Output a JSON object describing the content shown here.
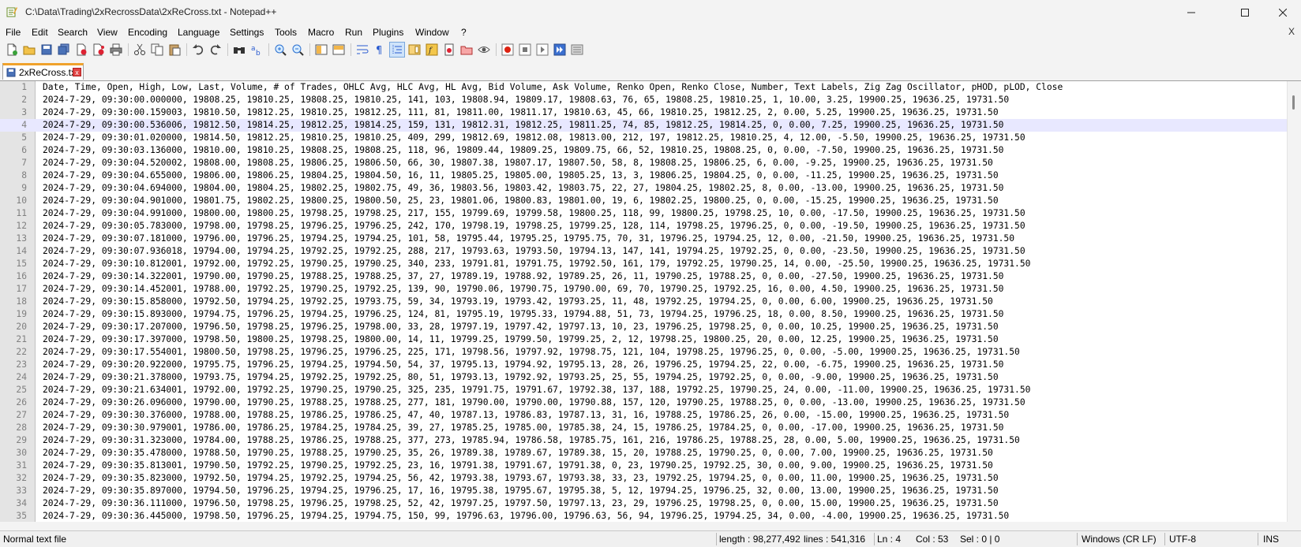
{
  "window": {
    "title": "C:\\Data\\Trading\\2xRecrossData\\2xReCross.txt - Notepad++",
    "minimize": "–",
    "maximize": "☐",
    "close": "✕"
  },
  "menu": {
    "items": [
      "File",
      "Edit",
      "Search",
      "View",
      "Encoding",
      "Language",
      "Settings",
      "Tools",
      "Macro",
      "Run",
      "Plugins",
      "Window",
      "?"
    ],
    "close_doc": "X"
  },
  "toolbar": {
    "icons": [
      "new-file-icon",
      "open-file-icon",
      "save-icon",
      "save-all-icon",
      "close-icon",
      "close-all-icon",
      "print-icon",
      "cut-icon",
      "copy-icon",
      "paste-icon",
      "undo-icon",
      "redo-icon",
      "find-icon",
      "replace-icon",
      "zoom-in-icon",
      "zoom-out-icon",
      "sync-vertical-icon",
      "sync-horizontal-icon",
      "word-wrap-icon",
      "show-all-characters-icon",
      "indent-guide-icon",
      "document-map-icon",
      "function-list-icon",
      "folder-as-workspace-icon",
      "project-panel-icon",
      "monitoring-icon",
      "record-macro-icon",
      "stop-recording-icon",
      "playback-macro-icon",
      "run-macro-multiple-icon",
      "save-macro-icon"
    ]
  },
  "tab": {
    "label": "2xReCross.txt",
    "close": "x"
  },
  "editor": {
    "current_line": 4,
    "lines": [
      "Date, Time, Open, High, Low, Last, Volume, # of Trades, OHLC Avg, HLC Avg, HL Avg, Bid Volume, Ask Volume, Renko Open, Renko Close, Number, Text Labels, Zig Zag Oscillator, pHOD, pLOD, Close",
      "2024-7-29, 09:30:00.000000, 19808.25, 19810.25, 19808.25, 19810.25, 141, 103, 19808.94, 19809.17, 19808.63, 76, 65, 19808.25, 19810.25, 1, 10.00, 3.25, 19900.25, 19636.25, 19731.50",
      "2024-7-29, 09:30:00.159003, 19810.50, 19812.25, 19810.25, 19812.25, 111, 81, 19811.00, 19811.17, 19810.63, 45, 66, 19810.25, 19812.25, 2, 0.00, 5.25, 19900.25, 19636.25, 19731.50",
      "2024-7-29, 09:30:00.536006, 19812.50, 19814.25, 19812.25, 19814.25, 159, 131, 19812.31, 19812.25, 19811.25, 74, 85, 19812.25, 19814.25, 0, 0.00, 7.25, 19900.25, 19636.25, 19731.50",
      "2024-7-29, 09:30:01.020000, 19814.50, 19812.25, 19810.25, 19810.25, 409, 299, 19812.69, 19812.08, 19813.00, 212, 197, 19812.25, 19810.25, 4, 12.00, -5.50, 19900.25, 19636.25, 19731.50",
      "2024-7-29, 09:30:03.136000, 19810.00, 19810.25, 19808.25, 19808.25, 118, 96, 19809.44, 19809.25, 19809.75, 66, 52, 19810.25, 19808.25, 0, 0.00, -7.50, 19900.25, 19636.25, 19731.50",
      "2024-7-29, 09:30:04.520002, 19808.00, 19808.25, 19806.25, 19806.50, 66, 30, 19807.38, 19807.17, 19807.50, 58, 8, 19808.25, 19806.25, 6, 0.00, -9.25, 19900.25, 19636.25, 19731.50",
      "2024-7-29, 09:30:04.655000, 19806.00, 19806.25, 19804.25, 19804.50, 16, 11, 19805.25, 19805.00, 19805.25, 13, 3, 19806.25, 19804.25, 0, 0.00, -11.25, 19900.25, 19636.25, 19731.50",
      "2024-7-29, 09:30:04.694000, 19804.00, 19804.25, 19802.25, 19802.75, 49, 36, 19803.56, 19803.42, 19803.75, 22, 27, 19804.25, 19802.25, 8, 0.00, -13.00, 19900.25, 19636.25, 19731.50",
      "2024-7-29, 09:30:04.901000, 19801.75, 19802.25, 19800.25, 19800.50, 25, 23, 19801.06, 19800.83, 19801.00, 19, 6, 19802.25, 19800.25, 0, 0.00, -15.25, 19900.25, 19636.25, 19731.50",
      "2024-7-29, 09:30:04.991000, 19800.00, 19800.25, 19798.25, 19798.25, 217, 155, 19799.69, 19799.58, 19800.25, 118, 99, 19800.25, 19798.25, 10, 0.00, -17.50, 19900.25, 19636.25, 19731.50",
      "2024-7-29, 09:30:05.783000, 19798.00, 19798.25, 19796.25, 19796.25, 242, 170, 19798.19, 19798.25, 19799.25, 128, 114, 19798.25, 19796.25, 0, 0.00, -19.50, 19900.25, 19636.25, 19731.50",
      "2024-7-29, 09:30:07.181000, 19796.00, 19796.25, 19794.25, 19794.25, 101, 58, 19795.44, 19795.25, 19795.75, 70, 31, 19796.25, 19794.25, 12, 0.00, -21.50, 19900.25, 19636.25, 19731.50",
      "2024-7-29, 09:30:07.936018, 19794.00, 19794.25, 19792.25, 19792.25, 288, 217, 19793.63, 19793.50, 19794.13, 147, 141, 19794.25, 19792.25, 0, 0.00, -23.50, 19900.25, 19636.25, 19731.50",
      "2024-7-29, 09:30:10.812001, 19792.00, 19792.25, 19790.25, 19790.25, 340, 233, 19791.81, 19791.75, 19792.50, 161, 179, 19792.25, 19790.25, 14, 0.00, -25.50, 19900.25, 19636.25, 19731.50",
      "2024-7-29, 09:30:14.322001, 19790.00, 19790.25, 19788.25, 19788.25, 37, 27, 19789.19, 19788.92, 19789.25, 26, 11, 19790.25, 19788.25, 0, 0.00, -27.50, 19900.25, 19636.25, 19731.50",
      "2024-7-29, 09:30:14.452001, 19788.00, 19792.25, 19790.25, 19792.25, 139, 90, 19790.06, 19790.75, 19790.00, 69, 70, 19790.25, 19792.25, 16, 0.00, 4.50, 19900.25, 19636.25, 19731.50",
      "2024-7-29, 09:30:15.858000, 19792.50, 19794.25, 19792.25, 19793.75, 59, 34, 19793.19, 19793.42, 19793.25, 11, 48, 19792.25, 19794.25, 0, 0.00, 6.00, 19900.25, 19636.25, 19731.50",
      "2024-7-29, 09:30:15.893000, 19794.75, 19796.25, 19794.25, 19796.25, 124, 81, 19795.19, 19795.33, 19794.88, 51, 73, 19794.25, 19796.25, 18, 0.00, 8.50, 19900.25, 19636.25, 19731.50",
      "2024-7-29, 09:30:17.207000, 19796.50, 19798.25, 19796.25, 19798.00, 33, 28, 19797.19, 19797.42, 19797.13, 10, 23, 19796.25, 19798.25, 0, 0.00, 10.25, 19900.25, 19636.25, 19731.50",
      "2024-7-29, 09:30:17.397000, 19798.50, 19800.25, 19798.25, 19800.00, 14, 11, 19799.25, 19799.50, 19799.25, 2, 12, 19798.25, 19800.25, 20, 0.00, 12.25, 19900.25, 19636.25, 19731.50",
      "2024-7-29, 09:30:17.554001, 19800.50, 19798.25, 19796.25, 19796.25, 225, 171, 19798.56, 19797.92, 19798.75, 121, 104, 19798.25, 19796.25, 0, 0.00, -5.00, 19900.25, 19636.25, 19731.50",
      "2024-7-29, 09:30:20.922000, 19795.75, 19796.25, 19794.25, 19794.50, 54, 37, 19795.13, 19794.92, 19795.13, 28, 26, 19796.25, 19794.25, 22, 0.00, -6.75, 19900.25, 19636.25, 19731.50",
      "2024-7-29, 09:30:21.378000, 19793.75, 19794.25, 19792.25, 19792.25, 80, 51, 19793.13, 19792.92, 19793.25, 25, 55, 19794.25, 19792.25, 0, 0.00, -9.00, 19900.25, 19636.25, 19731.50",
      "2024-7-29, 09:30:21.634001, 19792.00, 19792.25, 19790.25, 19790.25, 325, 235, 19791.75, 19791.67, 19792.38, 137, 188, 19792.25, 19790.25, 24, 0.00, -11.00, 19900.25, 19636.25, 19731.50",
      "2024-7-29, 09:30:26.096000, 19790.00, 19790.25, 19788.25, 19788.25, 277, 181, 19790.00, 19790.00, 19790.88, 157, 120, 19790.25, 19788.25, 0, 0.00, -13.00, 19900.25, 19636.25, 19731.50",
      "2024-7-29, 09:30:30.376000, 19788.00, 19788.25, 19786.25, 19786.25, 47, 40, 19787.13, 19786.83, 19787.13, 31, 16, 19788.25, 19786.25, 26, 0.00, -15.00, 19900.25, 19636.25, 19731.50",
      "2024-7-29, 09:30:30.979001, 19786.00, 19786.25, 19784.25, 19784.25, 39, 27, 19785.25, 19785.00, 19785.38, 24, 15, 19786.25, 19784.25, 0, 0.00, -17.00, 19900.25, 19636.25, 19731.50",
      "2024-7-29, 09:30:31.323000, 19784.00, 19788.25, 19786.25, 19788.25, 377, 273, 19785.94, 19786.58, 19785.75, 161, 216, 19786.25, 19788.25, 28, 0.00, 5.00, 19900.25, 19636.25, 19731.50",
      "2024-7-29, 09:30:35.478000, 19788.50, 19790.25, 19788.25, 19790.25, 35, 26, 19789.38, 19789.67, 19789.38, 15, 20, 19788.25, 19790.25, 0, 0.00, 7.00, 19900.25, 19636.25, 19731.50",
      "2024-7-29, 09:30:35.813001, 19790.50, 19792.25, 19790.25, 19792.25, 23, 16, 19791.38, 19791.67, 19791.38, 0, 23, 19790.25, 19792.25, 30, 0.00, 9.00, 19900.25, 19636.25, 19731.50",
      "2024-7-29, 09:30:35.823000, 19792.50, 19794.25, 19792.25, 19794.25, 56, 42, 19793.38, 19793.67, 19793.38, 33, 23, 19792.25, 19794.25, 0, 0.00, 11.00, 19900.25, 19636.25, 19731.50",
      "2024-7-29, 09:30:35.897000, 19794.50, 19796.25, 19794.25, 19796.25, 17, 16, 19795.38, 19795.67, 19795.38, 5, 12, 19794.25, 19796.25, 32, 0.00, 13.00, 19900.25, 19636.25, 19731.50",
      "2024-7-29, 09:30:36.111000, 19796.50, 19798.25, 19796.25, 19798.25, 52, 42, 19797.25, 19797.50, 19797.13, 23, 29, 19796.25, 19798.25, 0, 0.00, 15.00, 19900.25, 19636.25, 19731.50",
      "2024-7-29, 09:30:36.445000, 19798.50, 19796.25, 19794.25, 19794.75, 150, 99, 19796.63, 19796.00, 19796.63, 56, 94, 19796.25, 19794.25, 34, 0.00, -4.00, 19900.25, 19636.25, 19731.50"
    ]
  },
  "status": {
    "file_type": "Normal text file",
    "length": "length : 98,277,492",
    "lines": "lines : 541,316",
    "ln": "Ln : 4",
    "col": "Col : 53",
    "sel": "Sel : 0 | 0",
    "eol": "Windows (CR LF)",
    "encoding": "UTF-8",
    "mode": "INS"
  }
}
